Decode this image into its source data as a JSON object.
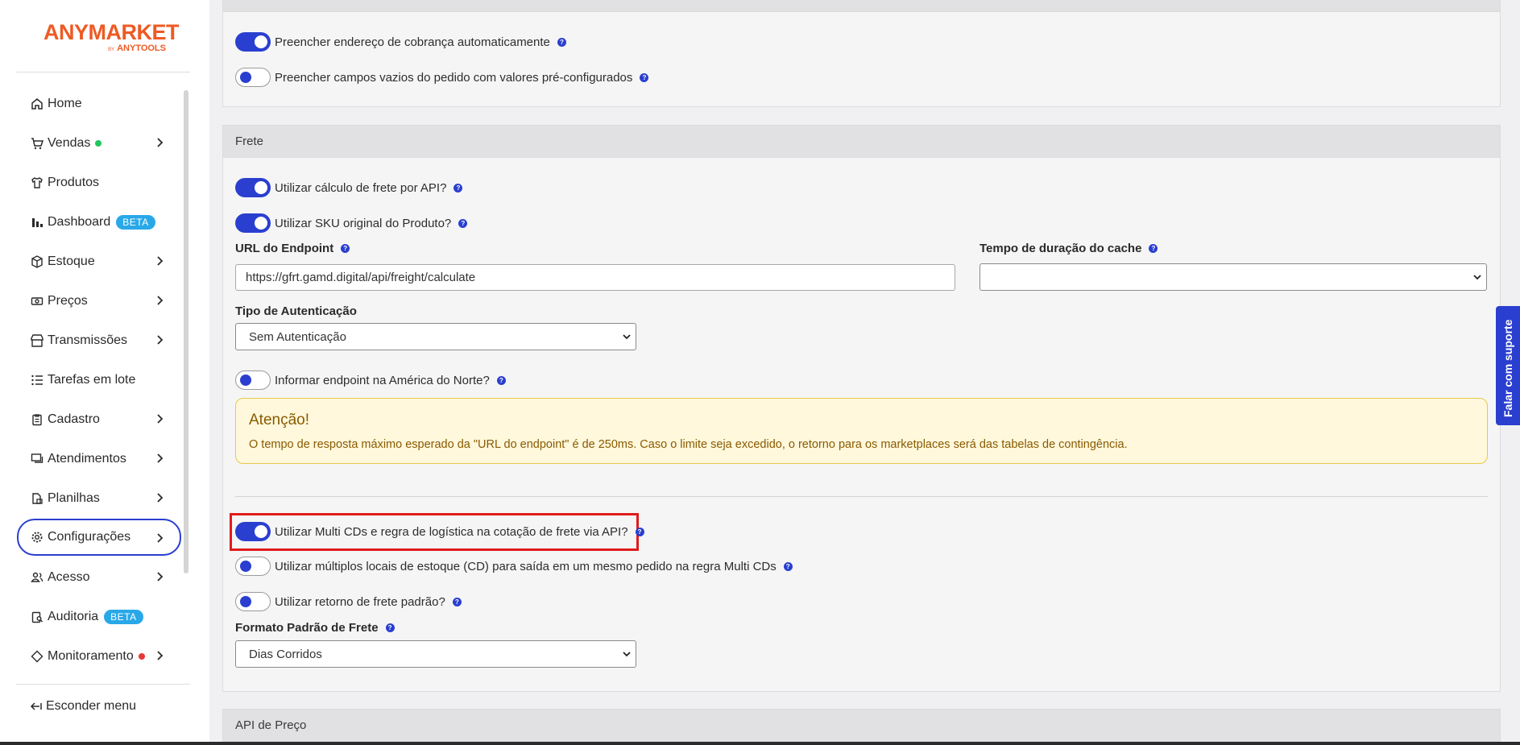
{
  "brand": {
    "name": "ANYMARKET",
    "by": "BY",
    "maker": "ANYTOOLS"
  },
  "sidebar": {
    "items": [
      {
        "label": "Home",
        "icon": "home-icon"
      },
      {
        "label": "Vendas",
        "icon": "cart-icon",
        "status_color": "#22c55e"
      },
      {
        "label": "Produtos",
        "icon": "shirt-icon"
      },
      {
        "label": "Dashboard",
        "icon": "bar-chart-icon",
        "badge": "BETA"
      },
      {
        "label": "Estoque",
        "icon": "box-icon"
      },
      {
        "label": "Preços",
        "icon": "money-icon"
      },
      {
        "label": "Transmissões",
        "icon": "store-icon"
      },
      {
        "label": "Tarefas em lote",
        "icon": "list-icon"
      },
      {
        "label": "Cadastro",
        "icon": "clipboard-icon"
      },
      {
        "label": "Atendimentos",
        "icon": "chat-icon"
      },
      {
        "label": "Planilhas",
        "icon": "sheet-icon"
      },
      {
        "label": "Configurações",
        "icon": "gear-icon",
        "active": true
      },
      {
        "label": "Acesso",
        "icon": "users-icon"
      },
      {
        "label": "Auditoria",
        "icon": "audit-icon",
        "badge": "BETA"
      },
      {
        "label": "Monitoramento",
        "icon": "diamond-icon",
        "status_color": "#e53935"
      }
    ],
    "hide_menu": "Esconder menu"
  },
  "top_section": {
    "toggles": [
      {
        "label": "Preencher endereço de cobrança automaticamente",
        "on": true
      },
      {
        "label": "Preencher campos vazios do pedido com valores pré-configurados",
        "on": false
      }
    ]
  },
  "frete": {
    "title": "Frete",
    "toggle_api": {
      "label": "Utilizar cálculo de frete por API?",
      "on": true
    },
    "toggle_sku": {
      "label": "Utilizar SKU original do Produto?",
      "on": true
    },
    "endpoint_label": "URL do Endpoint",
    "endpoint_value": "https://gfrt.gamd.digital/api/freight/calculate",
    "cache_label": "Tempo de duração do cache",
    "cache_value": "",
    "auth_label": "Tipo de Autenticação",
    "auth_value": "Sem Autenticação",
    "toggle_na": {
      "label": "Informar endpoint na América do Norte?",
      "on": false
    },
    "alert_title": "Atenção!",
    "alert_text": "O tempo de resposta máximo esperado da \"URL do endpoint\" é de 250ms. Caso o limite seja excedido, o retorno para os marketplaces será das tabelas de contingência.",
    "toggle_multi": {
      "label": "Utilizar Multi CDs e regra de logística na cotação de frete via API?",
      "on": true
    },
    "toggle_multi_locais": {
      "label": "Utilizar múltiplos locais de estoque (CD) para saída em um mesmo pedido na regra Multi CDs",
      "on": false
    },
    "toggle_padrao": {
      "label": "Utilizar retorno de frete padrão?",
      "on": false
    },
    "formato_label": "Formato Padrão de Frete",
    "formato_value": "Dias Corridos"
  },
  "api_preco": {
    "title": "API de Preço"
  },
  "support": {
    "label": "Falar com suporte"
  },
  "colors": {
    "accent": "#2a3fcf",
    "brand": "#ee5a24",
    "highlight": "#e01b1b",
    "beta": "#29a8e8"
  }
}
